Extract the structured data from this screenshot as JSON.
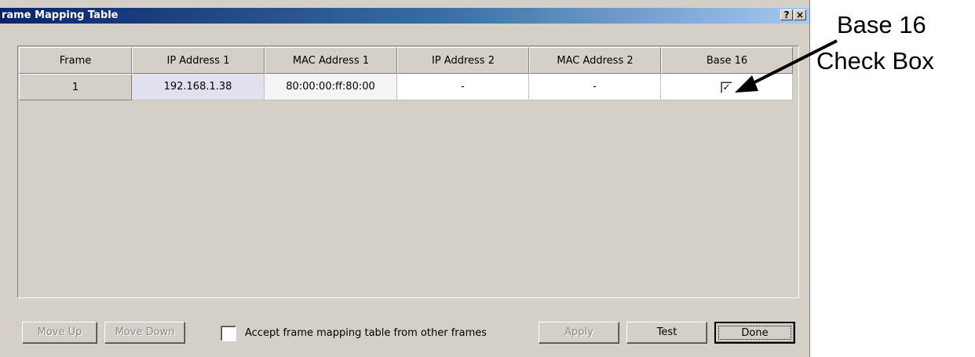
{
  "window": {
    "title": "rame Mapping Table",
    "help_glyph": "?",
    "close_glyph": "×"
  },
  "table": {
    "columns": [
      "Frame",
      "IP Address 1",
      "MAC Address 1",
      "IP Address 2",
      "MAC Address 2",
      "Base 16"
    ],
    "rows": [
      {
        "frame": "1",
        "ip1": "192.168.1.38",
        "mac1": "80:00:00:ff:80:00",
        "ip2": "-",
        "mac2": "-",
        "base16_checked": true,
        "check_glyph": "✓"
      }
    ]
  },
  "buttons": {
    "move_up": "Move Up",
    "move_down": "Move Down",
    "apply": "Apply",
    "test": "Test",
    "done": "Done"
  },
  "accept": {
    "label": "Accept frame mapping table from other frames",
    "checked": false
  },
  "annotation": {
    "line1": "Base 16",
    "line2": "Check Box"
  },
  "colors": {
    "dialog_bg": "#d4d0c8",
    "title_gradient_start": "#0a246a",
    "title_gradient_end": "#a6caf0",
    "selected_cell": "#e2e0ee"
  }
}
